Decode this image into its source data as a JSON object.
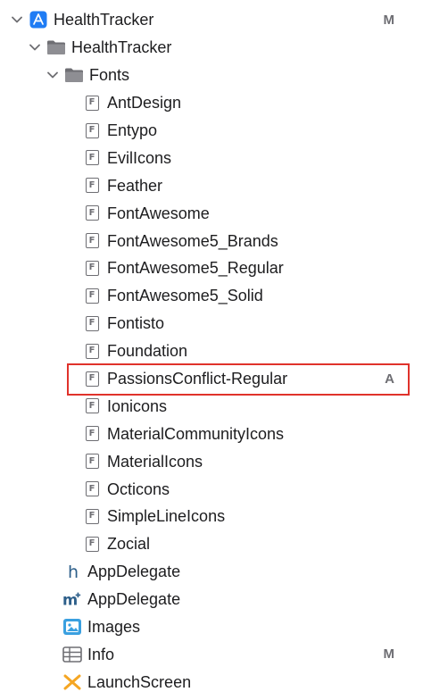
{
  "navigator": {
    "project": {
      "label": "HealthTracker",
      "badge": "M",
      "icon": "xcode-project-icon"
    },
    "group": {
      "label": "HealthTracker",
      "icon": "folder-icon"
    },
    "fonts_folder": {
      "label": "Fonts",
      "icon": "folder-icon"
    },
    "font_files": [
      {
        "label": "AntDesign",
        "badge": ""
      },
      {
        "label": "Entypo",
        "badge": ""
      },
      {
        "label": "EvilIcons",
        "badge": ""
      },
      {
        "label": "Feather",
        "badge": ""
      },
      {
        "label": "FontAwesome",
        "badge": ""
      },
      {
        "label": "FontAwesome5_Brands",
        "badge": ""
      },
      {
        "label": "FontAwesome5_Regular",
        "badge": ""
      },
      {
        "label": "FontAwesome5_Solid",
        "badge": ""
      },
      {
        "label": "Fontisto",
        "badge": ""
      },
      {
        "label": "Foundation",
        "badge": ""
      },
      {
        "label": "PassionsConflict-Regular",
        "badge": "A"
      },
      {
        "label": "Ionicons",
        "badge": ""
      },
      {
        "label": "MaterialCommunityIcons",
        "badge": ""
      },
      {
        "label": "MaterialIcons",
        "badge": ""
      },
      {
        "label": "Octicons",
        "badge": ""
      },
      {
        "label": "SimpleLineIcons",
        "badge": ""
      },
      {
        "label": "Zocial",
        "badge": ""
      }
    ],
    "font_file_glyph": "F",
    "other_files": [
      {
        "label": "AppDelegate",
        "badge": "",
        "icon": "header-file-icon"
      },
      {
        "label": "AppDelegate",
        "badge": "",
        "icon": "objc-implementation-icon"
      },
      {
        "label": "Images",
        "badge": "",
        "icon": "asset-catalog-icon"
      },
      {
        "label": "Info",
        "badge": "M",
        "icon": "plist-icon"
      },
      {
        "label": "LaunchScreen",
        "badge": "",
        "icon": "storyboard-icon"
      }
    ]
  },
  "colors": {
    "highlight_border": "#e0322b",
    "project_icon": "#1f7cf4",
    "objc_icon": "#2d5f8a",
    "assets_icon": "#3aa0e0",
    "storyboard_icon": "#f5a623",
    "text": "#1d1d1f",
    "secondary": "#6e6e73"
  }
}
